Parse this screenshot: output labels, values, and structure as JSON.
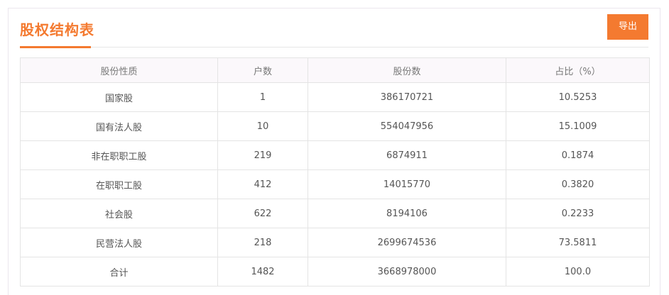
{
  "header": {
    "title": "股权结构表",
    "export_label": "导出"
  },
  "table": {
    "columns": [
      "股份性质",
      "户数",
      "股份数",
      "占比（%）"
    ],
    "rows": [
      [
        "国家股",
        "1",
        "386170721",
        "10.5253"
      ],
      [
        "国有法人股",
        "10",
        "554047956",
        "15.1009"
      ],
      [
        "非在职职工股",
        "219",
        "6874911",
        "0.1874"
      ],
      [
        "在职职工股",
        "412",
        "14015770",
        "0.3820"
      ],
      [
        "社会股",
        "622",
        "8194106",
        "0.2233"
      ],
      [
        "民营法人股",
        "218",
        "2699674536",
        "73.5811"
      ],
      [
        "合计",
        "1482",
        "3668978000",
        "100.0"
      ]
    ]
  },
  "colors": {
    "accent": "#f47a30",
    "header_bg": "#fbf8fb",
    "border": "#e4e4e4"
  }
}
